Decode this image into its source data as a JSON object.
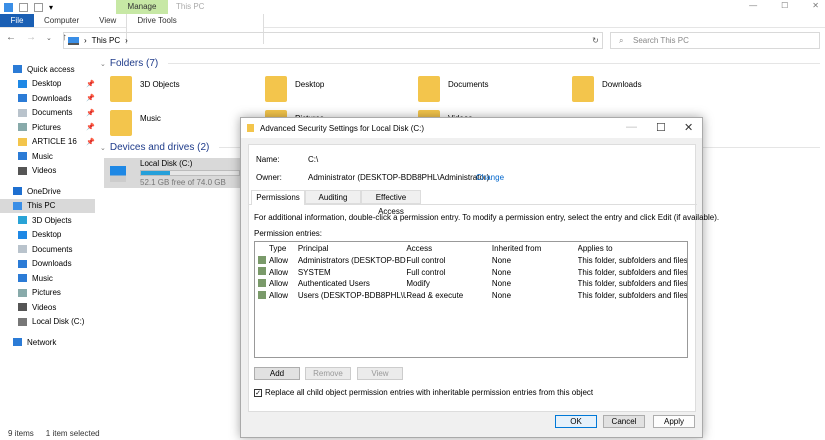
{
  "ribbon": {
    "contextual_tab": "Manage",
    "window_title": "This PC",
    "tabs": [
      "File",
      "Computer",
      "View",
      "Drive Tools"
    ]
  },
  "address": {
    "path": "This PC",
    "search_placeholder": "Search This PC"
  },
  "sidebar": {
    "items": [
      {
        "label": "Quick access",
        "icon": "star-icon",
        "color": "#2b7bd6"
      },
      {
        "label": "Desktop",
        "icon": "desktop-icon",
        "color": "#1e88e5",
        "pinned": true
      },
      {
        "label": "Downloads",
        "icon": "downloads-icon",
        "color": "#2b7bd6",
        "pinned": true
      },
      {
        "label": "Documents",
        "icon": "documents-icon",
        "color": "#b9c3cc",
        "pinned": true
      },
      {
        "label": "Pictures",
        "icon": "pictures-icon",
        "color": "#8aa",
        "pinned": true
      },
      {
        "label": "ARTICLE 16",
        "icon": "folder-icon",
        "color": "#f3c54c",
        "pinned": true
      },
      {
        "label": "Music",
        "icon": "music-icon",
        "color": "#2b7bd6"
      },
      {
        "label": "Videos",
        "icon": "videos-icon",
        "color": "#555"
      },
      {
        "label": "OneDrive",
        "icon": "cloud-icon",
        "color": "#1e6fd0"
      },
      {
        "label": "This PC",
        "icon": "pc-icon",
        "color": "#3a8ee6",
        "selected": true
      },
      {
        "label": "3D Objects",
        "icon": "cube-icon",
        "color": "#29a3d6"
      },
      {
        "label": "Desktop",
        "icon": "desktop-icon",
        "color": "#1e88e5"
      },
      {
        "label": "Documents",
        "icon": "documents-icon",
        "color": "#b9c3cc"
      },
      {
        "label": "Downloads",
        "icon": "downloads-icon",
        "color": "#2b7bd6"
      },
      {
        "label": "Music",
        "icon": "music-icon",
        "color": "#2b7bd6"
      },
      {
        "label": "Pictures",
        "icon": "pictures-icon",
        "color": "#8aa"
      },
      {
        "label": "Videos",
        "icon": "videos-icon",
        "color": "#555"
      },
      {
        "label": "Local Disk (C:)",
        "icon": "drive-icon",
        "color": "#777"
      },
      {
        "label": "Network",
        "icon": "network-icon",
        "color": "#2b7bd6"
      }
    ]
  },
  "main": {
    "folders_header": "Folders (7)",
    "folders": [
      "3D Objects",
      "Desktop",
      "Documents",
      "Downloads",
      "Music",
      "Pictures",
      "Videos"
    ],
    "devices_header": "Devices and drives (2)",
    "drive": {
      "name": "Local Disk (C:)",
      "free": "52.1 GB free of 74.0 GB",
      "used_fraction": 0.296
    }
  },
  "status": {
    "items": "9 items",
    "selected": "1 item selected"
  },
  "dialog": {
    "title": "Advanced Security Settings for Local Disk (C:)",
    "name_label": "Name:",
    "name_value": "C:\\",
    "owner_label": "Owner:",
    "owner_value": "Administrator (DESKTOP-BDB8PHL\\Administrator)",
    "change_link": "Change",
    "tabs": [
      "Permissions",
      "Auditing",
      "Effective Access"
    ],
    "info": "For additional information, double-click a permission entry. To modify a permission entry, select the entry and click Edit (if available).",
    "entries_label": "Permission entries:",
    "columns": [
      "Type",
      "Principal",
      "Access",
      "Inherited from",
      "Applies to"
    ],
    "rows": [
      [
        "Allow",
        "Administrators (DESKTOP-BD...",
        "Full control",
        "None",
        "This folder, subfolders and files"
      ],
      [
        "Allow",
        "SYSTEM",
        "Full control",
        "None",
        "This folder, subfolders and files"
      ],
      [
        "Allow",
        "Authenticated Users",
        "Modify",
        "None",
        "This folder, subfolders and files"
      ],
      [
        "Allow",
        "Users (DESKTOP-BDB8PHL\\Us...",
        "Read & execute",
        "None",
        "This folder, subfolders and files"
      ]
    ],
    "add": "Add",
    "remove": "Remove",
    "view": "View",
    "replace_checkbox": "Replace all child object permission entries with inheritable permission entries from this object",
    "replace_checked": true,
    "ok": "OK",
    "cancel": "Cancel",
    "apply": "Apply"
  }
}
